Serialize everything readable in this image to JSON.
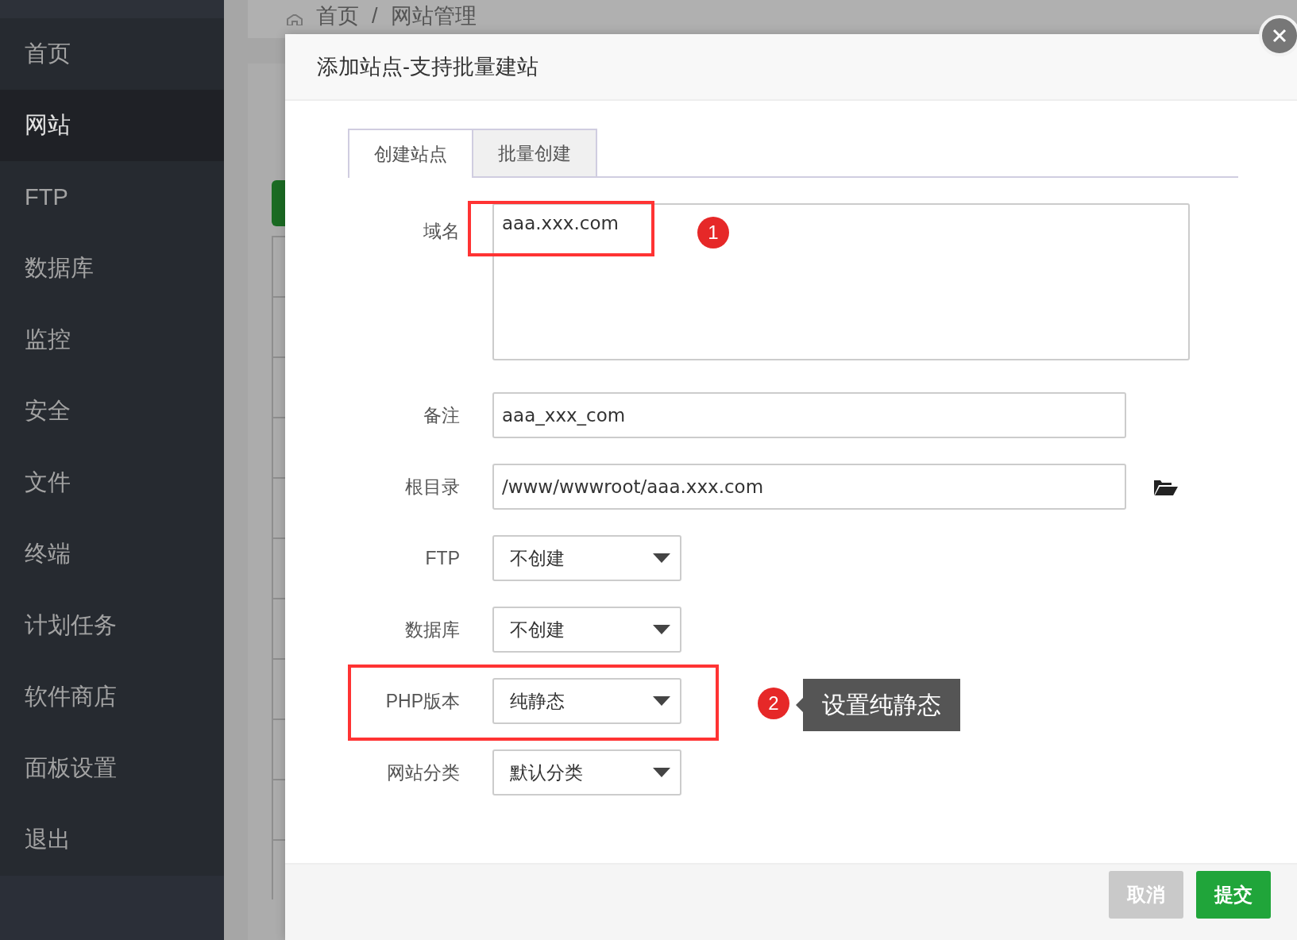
{
  "sidebar": {
    "items": [
      {
        "label": "首页",
        "selected": false
      },
      {
        "label": "网站",
        "selected": true
      },
      {
        "label": "FTP",
        "selected": false
      },
      {
        "label": "数据库",
        "selected": false
      },
      {
        "label": "监控",
        "selected": false
      },
      {
        "label": "安全",
        "selected": false
      },
      {
        "label": "文件",
        "selected": false
      },
      {
        "label": "终端",
        "selected": false
      },
      {
        "label": "计划任务",
        "selected": false
      },
      {
        "label": "软件商店",
        "selected": false
      },
      {
        "label": "面板设置",
        "selected": false
      },
      {
        "label": "退出",
        "selected": false
      }
    ]
  },
  "breadcrumb": {
    "items": [
      "首页",
      "网站管理"
    ],
    "separator": "/"
  },
  "dialog": {
    "title": "添加站点-支持批量建站",
    "tabs": [
      {
        "label": "创建站点",
        "selected": true
      },
      {
        "label": "批量创建",
        "selected": false
      }
    ],
    "fields": [
      {
        "label": "域名",
        "kind": "textarea",
        "value": "aaa.xxx.com",
        "annotation": {
          "number": "1",
          "kind": "input"
        }
      },
      {
        "label": "备注",
        "kind": "input",
        "value": "aaa_xxx_com"
      },
      {
        "label": "根目录",
        "kind": "path",
        "value": "/www/wwwroot/aaa.xxx.com"
      },
      {
        "label": "FTP",
        "kind": "select",
        "value": "不创建"
      },
      {
        "label": "数据库",
        "kind": "select",
        "value": "不创建"
      },
      {
        "label": "PHP版本",
        "kind": "select",
        "value": "纯静态",
        "annotation": {
          "number": "2",
          "kind": "row",
          "callout": "设置纯静态"
        }
      },
      {
        "label": "网站分类",
        "kind": "select",
        "value": "默认分类"
      }
    ],
    "buttons": [
      {
        "label": "取消",
        "kind": "secondary"
      },
      {
        "label": "提交",
        "kind": "primary"
      }
    ]
  }
}
